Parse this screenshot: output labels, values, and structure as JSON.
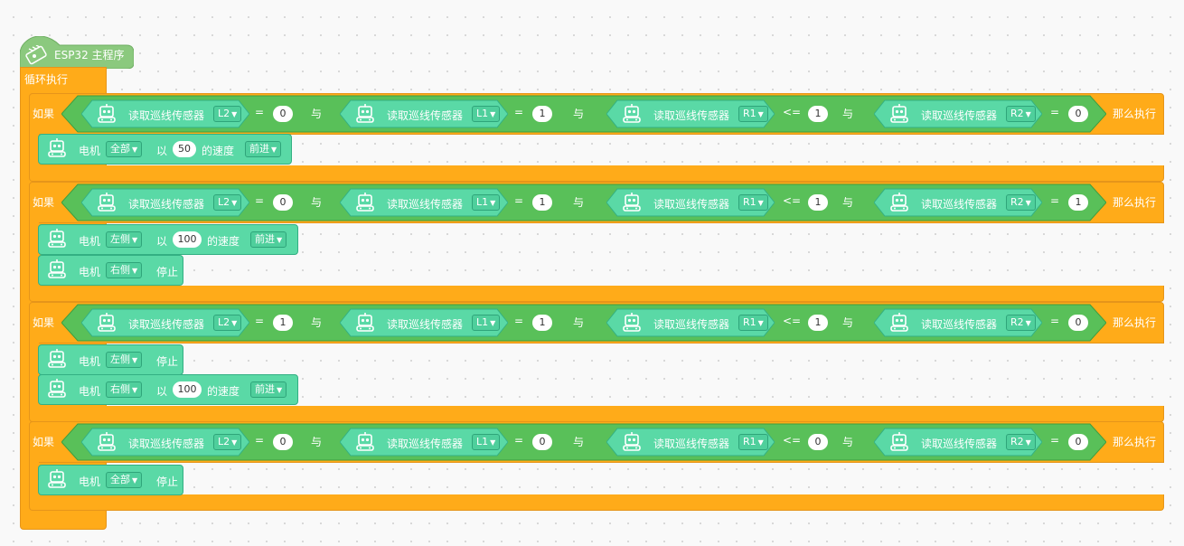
{
  "hat": {
    "label": "ESP32 主程序"
  },
  "loop": {
    "label": "循环执行"
  },
  "if_label": "如果",
  "then_label": "那么执行",
  "and_label": "与",
  "read_label": "读取巡线传感器",
  "ifs": [
    {
      "conditions": [
        {
          "sensor": "L2",
          "op": "=",
          "value": "0"
        },
        {
          "sensor": "L1",
          "op": "=",
          "value": "1"
        },
        {
          "sensor": "R1",
          "op": "<=",
          "value": "1"
        },
        {
          "sensor": "R2",
          "op": "=",
          "value": "0"
        }
      ],
      "actions": [
        {
          "label": "电机",
          "side": "全部",
          "kind": "speed",
          "prefix": "以",
          "speed": "50",
          "suffix": "的速度",
          "dir": "前进"
        }
      ]
    },
    {
      "conditions": [
        {
          "sensor": "L2",
          "op": "=",
          "value": "0"
        },
        {
          "sensor": "L1",
          "op": "=",
          "value": "1"
        },
        {
          "sensor": "R1",
          "op": "<=",
          "value": "1"
        },
        {
          "sensor": "R2",
          "op": "=",
          "value": "1"
        }
      ],
      "actions": [
        {
          "label": "电机",
          "side": "左侧",
          "kind": "speed",
          "prefix": "以",
          "speed": "100",
          "suffix": "的速度",
          "dir": "前进"
        },
        {
          "label": "电机",
          "side": "右侧",
          "kind": "stop",
          "stop": "停止"
        }
      ]
    },
    {
      "conditions": [
        {
          "sensor": "L2",
          "op": "=",
          "value": "1"
        },
        {
          "sensor": "L1",
          "op": "=",
          "value": "1"
        },
        {
          "sensor": "R1",
          "op": "<=",
          "value": "1"
        },
        {
          "sensor": "R2",
          "op": "=",
          "value": "0"
        }
      ],
      "actions": [
        {
          "label": "电机",
          "side": "左侧",
          "kind": "stop",
          "stop": "停止"
        },
        {
          "label": "电机",
          "side": "右侧",
          "kind": "speed",
          "prefix": "以",
          "speed": "100",
          "suffix": "的速度",
          "dir": "前进"
        }
      ]
    },
    {
      "conditions": [
        {
          "sensor": "L2",
          "op": "=",
          "value": "0"
        },
        {
          "sensor": "L1",
          "op": "=",
          "value": "0"
        },
        {
          "sensor": "R1",
          "op": "<=",
          "value": "0"
        },
        {
          "sensor": "R2",
          "op": "=",
          "value": "0"
        }
      ],
      "actions": [
        {
          "label": "电机",
          "side": "全部",
          "kind": "stop",
          "stop": "停止"
        }
      ]
    }
  ],
  "colors": {
    "control": "#ffab19",
    "logic": "#59c059",
    "sensor": "#5ad9a6",
    "hat": "#8bc97e"
  },
  "icons": {
    "hat": "esp32-board-icon",
    "robot": "robot-icon",
    "dropdown": "dropdown-arrow-icon"
  }
}
